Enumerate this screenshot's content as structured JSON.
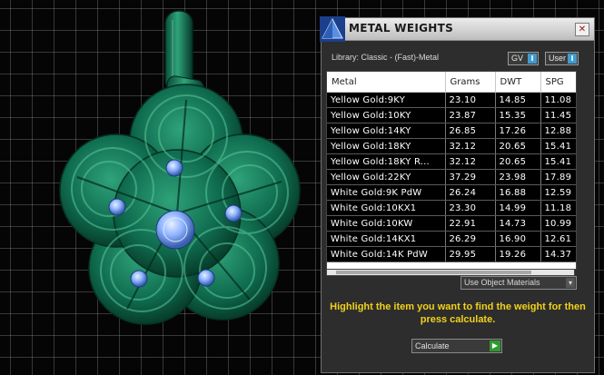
{
  "panel": {
    "title": "METAL WEIGHTS",
    "close_glyph": "✕",
    "library_label": "Library: Classic - (Fast)-Metal",
    "gv_toggle": {
      "label": "GV",
      "state": "I"
    },
    "user_toggle": {
      "label": "User",
      "state": "I"
    },
    "columns": [
      "Metal",
      "Grams",
      "DWT",
      "SPG"
    ],
    "rows": [
      [
        "Yellow Gold:9KY",
        "23.10",
        "14.85",
        "11.08"
      ],
      [
        "Yellow Gold:10KY",
        "23.87",
        "15.35",
        "11.45"
      ],
      [
        "Yellow Gold:14KY",
        "26.85",
        "17.26",
        "12.88"
      ],
      [
        "Yellow Gold:18KY",
        "32.12",
        "20.65",
        "15.41"
      ],
      [
        "Yellow Gold:18KY R...",
        "32.12",
        "20.65",
        "15.41"
      ],
      [
        "Yellow Gold:22KY",
        "37.29",
        "23.98",
        "17.89"
      ],
      [
        "White Gold:9K PdW",
        "26.24",
        "16.88",
        "12.59"
      ],
      [
        "White Gold:10KX1",
        "23.30",
        "14.99",
        "11.18"
      ],
      [
        "White Gold:10KW",
        "22.91",
        "14.73",
        "10.99"
      ],
      [
        "White Gold:14KX1",
        "26.29",
        "16.90",
        "12.61"
      ],
      [
        "White Gold:14K PdW",
        "29.95",
        "19.26",
        "14.37"
      ]
    ],
    "use_object_materials": "Use Object Materials",
    "instructions": "Highlight the item you want to find the weight for then press calculate.",
    "calculate_label": "Calculate"
  },
  "colors": {
    "pendant_green": "#0f6b4e",
    "gem_blue": "#8fb4ff",
    "instruction_yellow": "#f2d21a"
  }
}
